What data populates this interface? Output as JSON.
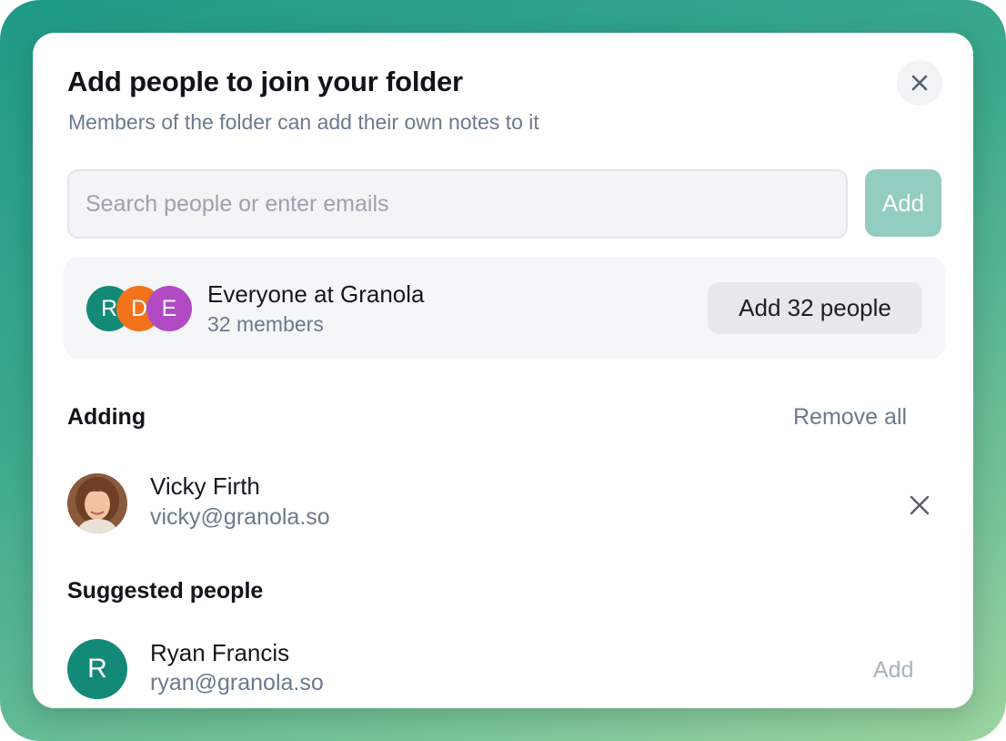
{
  "dialog": {
    "title": "Add people to join your folder",
    "subtitle": "Members of the folder can add their own notes to it",
    "close_icon": "close-icon"
  },
  "search": {
    "placeholder": "Search people or enter emails",
    "value": "",
    "add_label": "Add"
  },
  "group": {
    "name": "Everyone at Granola",
    "count_label": "32 members",
    "add_label": "Add 32 people",
    "avatars": [
      {
        "initial": "R",
        "color": "#138a77"
      },
      {
        "initial": "D",
        "color": "#f2731b"
      },
      {
        "initial": "E",
        "color": "#b04bc4"
      }
    ]
  },
  "adding": {
    "heading": "Adding",
    "remove_all_label": "Remove all",
    "people": [
      {
        "name": "Vicky Firth",
        "email": "vicky@granola.so",
        "avatar": "photo"
      }
    ]
  },
  "suggested": {
    "heading": "Suggested people",
    "people": [
      {
        "name": "Ryan Francis",
        "email": "ryan@granola.so",
        "initial": "R",
        "avatar_color": "#138a77",
        "add_label": "Add"
      }
    ]
  },
  "colors": {
    "accent": "#138a77",
    "add_button_disabled": "#93ccc0",
    "muted_text": "#6b7a8c"
  }
}
